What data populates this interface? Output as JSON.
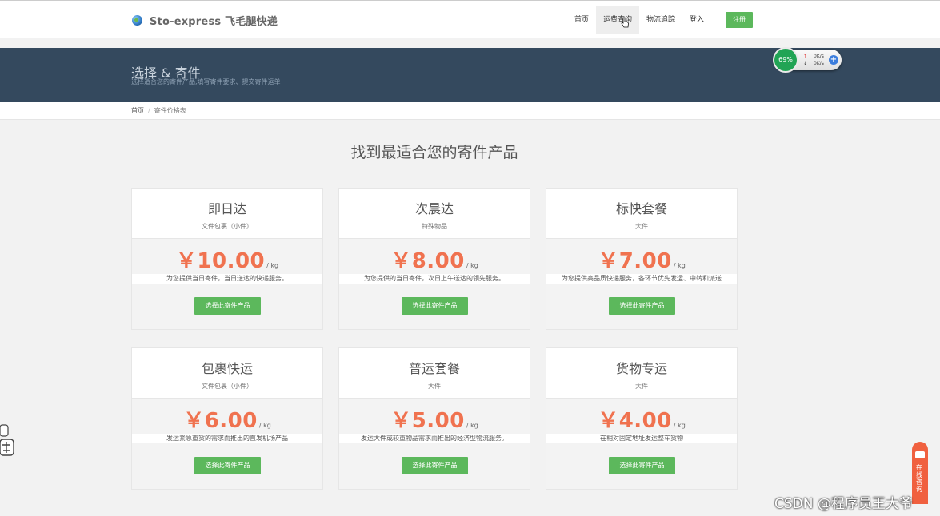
{
  "header": {
    "brand": "Sto-express 飞毛腿快递",
    "nav": [
      {
        "label": "首页",
        "active": false
      },
      {
        "label": "运费查询",
        "active": true
      },
      {
        "label": "物流追踪",
        "active": false
      },
      {
        "label": "登入",
        "active": false
      }
    ],
    "register_label": "注册"
  },
  "banner": {
    "title": "选择 & 寄件",
    "subtitle": "选择适合您的寄件产品,填写寄件要求、提交寄件运单"
  },
  "speed_widget": {
    "percent": "69%",
    "up": "0K/s",
    "down": "0K/s"
  },
  "breadcrumb": [
    "首页",
    "寄件价格表"
  ],
  "main": {
    "heading": "找到最适合您的寄件产品"
  },
  "products": [
    {
      "title": "即日达",
      "subtitle": "文件包裹（小件）",
      "price": "￥10.00",
      "unit": "/ kg",
      "desc": "为您提供当日寄件，当日送达的快递服务。",
      "button": "选择此寄件产品"
    },
    {
      "title": "次晨达",
      "subtitle": "特殊物品",
      "price": "￥8.00",
      "unit": "/ kg",
      "desc": "为您提供的当日寄件，次日上午送达的领先服务。",
      "button": "选择此寄件产品"
    },
    {
      "title": "标快套餐",
      "subtitle": "大件",
      "price": "￥7.00",
      "unit": "/ kg",
      "desc": "为您提供高品质快递服务，各环节优先发运、中转和派送",
      "button": "选择此寄件产品"
    },
    {
      "title": "包裹快运",
      "subtitle": "文件包裹（小件）",
      "price": "￥6.00",
      "unit": "/ kg",
      "desc": "发运紧急重货的需求而推出的直发机场产品",
      "button": "选择此寄件产品"
    },
    {
      "title": "普运套餐",
      "subtitle": "大件",
      "price": "￥5.00",
      "unit": "/ kg",
      "desc": "发运大件或较重物品需求而推出的经济型物流服务。",
      "button": "选择此寄件产品"
    },
    {
      "title": "货物专运",
      "subtitle": "大件",
      "price": "￥4.00",
      "unit": "/ kg",
      "desc": "在相对固定地址发运整车货物",
      "button": "选择此寄件产品"
    }
  ],
  "chat": {
    "label": "在线咨询"
  },
  "watermark": "CSDN @程序员王大爷",
  "colors": {
    "accent": "#5cb85c",
    "price": "#f0724f",
    "banner": "#34495e",
    "chat": "#f0603f"
  }
}
